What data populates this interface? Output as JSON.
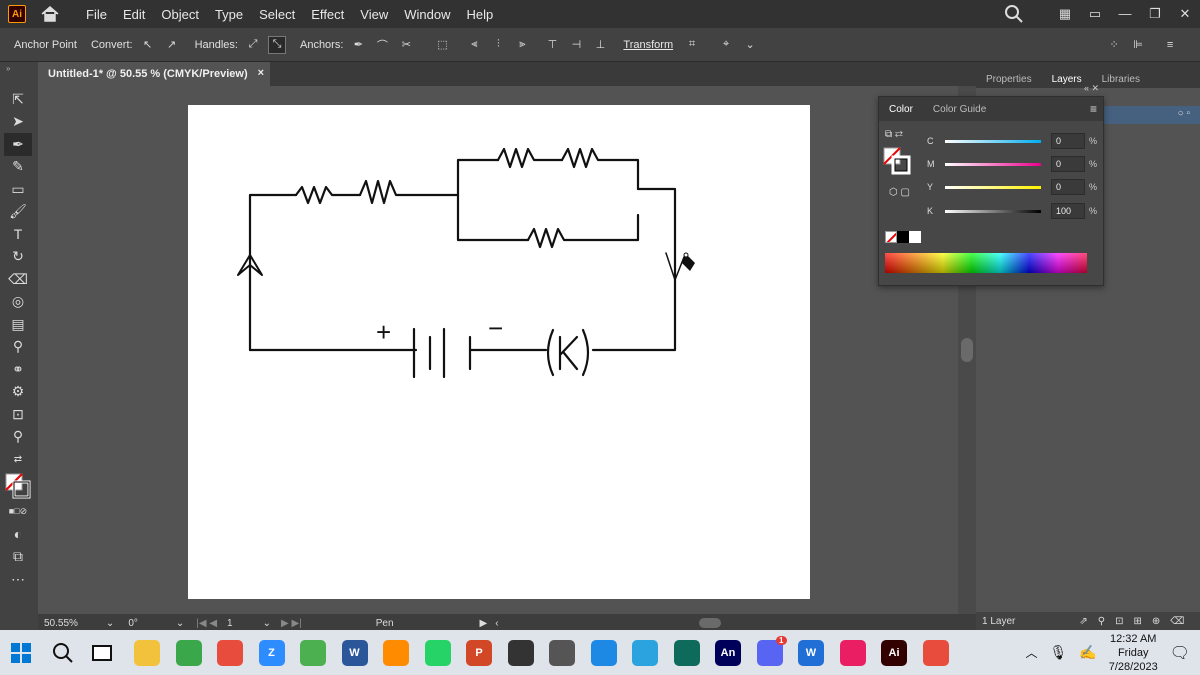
{
  "app": {
    "logo": "Ai"
  },
  "menu": [
    "File",
    "Edit",
    "Object",
    "Type",
    "Select",
    "Effect",
    "View",
    "Window",
    "Help"
  ],
  "control": {
    "tool_label": "Anchor Point",
    "convert_label": "Convert:",
    "handles_label": "Handles:",
    "anchors_label": "Anchors:",
    "transform_label": "Transform"
  },
  "document": {
    "tab_title": "Untitled-1* @ 50.55 % (CMYK/Preview)",
    "close": "×"
  },
  "status": {
    "zoom": "50.55%",
    "rotation": "0°",
    "artboard": "1",
    "tool": "Pen"
  },
  "right_dock": {
    "tabs": [
      "Properties",
      "Layers",
      "Libraries"
    ],
    "active_tab": "Layers",
    "layers_count": "1 Layer"
  },
  "color_panel": {
    "tabs": [
      "Color",
      "Color Guide"
    ],
    "active_tab": "Color",
    "channels": [
      {
        "label": "C",
        "value": "0",
        "color": "#00aeef"
      },
      {
        "label": "M",
        "value": "0",
        "color": "#ec008c"
      },
      {
        "label": "Y",
        "value": "0",
        "color": "#fff200"
      },
      {
        "label": "K",
        "value": "100",
        "color": "#000000"
      }
    ],
    "unit": "%"
  },
  "circuit": {
    "plus": "+",
    "minus": "−",
    "key": "K"
  },
  "taskbar": {
    "clock_time": "12:32 AM",
    "clock_day": "Friday",
    "clock_date": "7/28/2023",
    "apps": [
      {
        "name": "file-explorer",
        "color": "#f3c23c",
        "label": ""
      },
      {
        "name": "app-tricolor",
        "color": "#3aa84a",
        "label": ""
      },
      {
        "name": "chrome",
        "color": "#e74c3c",
        "label": ""
      },
      {
        "name": "zoom",
        "color": "#2d8cff",
        "label": "Z"
      },
      {
        "name": "notepad",
        "color": "#4caf50",
        "label": ""
      },
      {
        "name": "word",
        "color": "#2b579a",
        "label": "W"
      },
      {
        "name": "app-orange",
        "color": "#ff8c00",
        "label": ""
      },
      {
        "name": "whatsapp",
        "color": "#25d366",
        "label": ""
      },
      {
        "name": "powerpoint",
        "color": "#d24726",
        "label": "P"
      },
      {
        "name": "davinci",
        "color": "#333333",
        "label": ""
      },
      {
        "name": "chatgpt",
        "color": "#555555",
        "label": ""
      },
      {
        "name": "app-blue",
        "color": "#1e88e5",
        "label": ""
      },
      {
        "name": "telegram",
        "color": "#2aa3df",
        "label": ""
      },
      {
        "name": "terminal",
        "color": "#0e6b5c",
        "label": ""
      },
      {
        "name": "animate",
        "color": "#00005b",
        "label": "An"
      },
      {
        "name": "discord",
        "color": "#5865f2",
        "label": ""
      },
      {
        "name": "wps",
        "color": "#1f6fd6",
        "label": "W"
      },
      {
        "name": "app-pink",
        "color": "#e91e63",
        "label": ""
      },
      {
        "name": "illustrator",
        "color": "#330000",
        "label": "Ai"
      },
      {
        "name": "chrome-2",
        "color": "#e74c3c",
        "label": ""
      }
    ],
    "discord_badge": "1"
  }
}
